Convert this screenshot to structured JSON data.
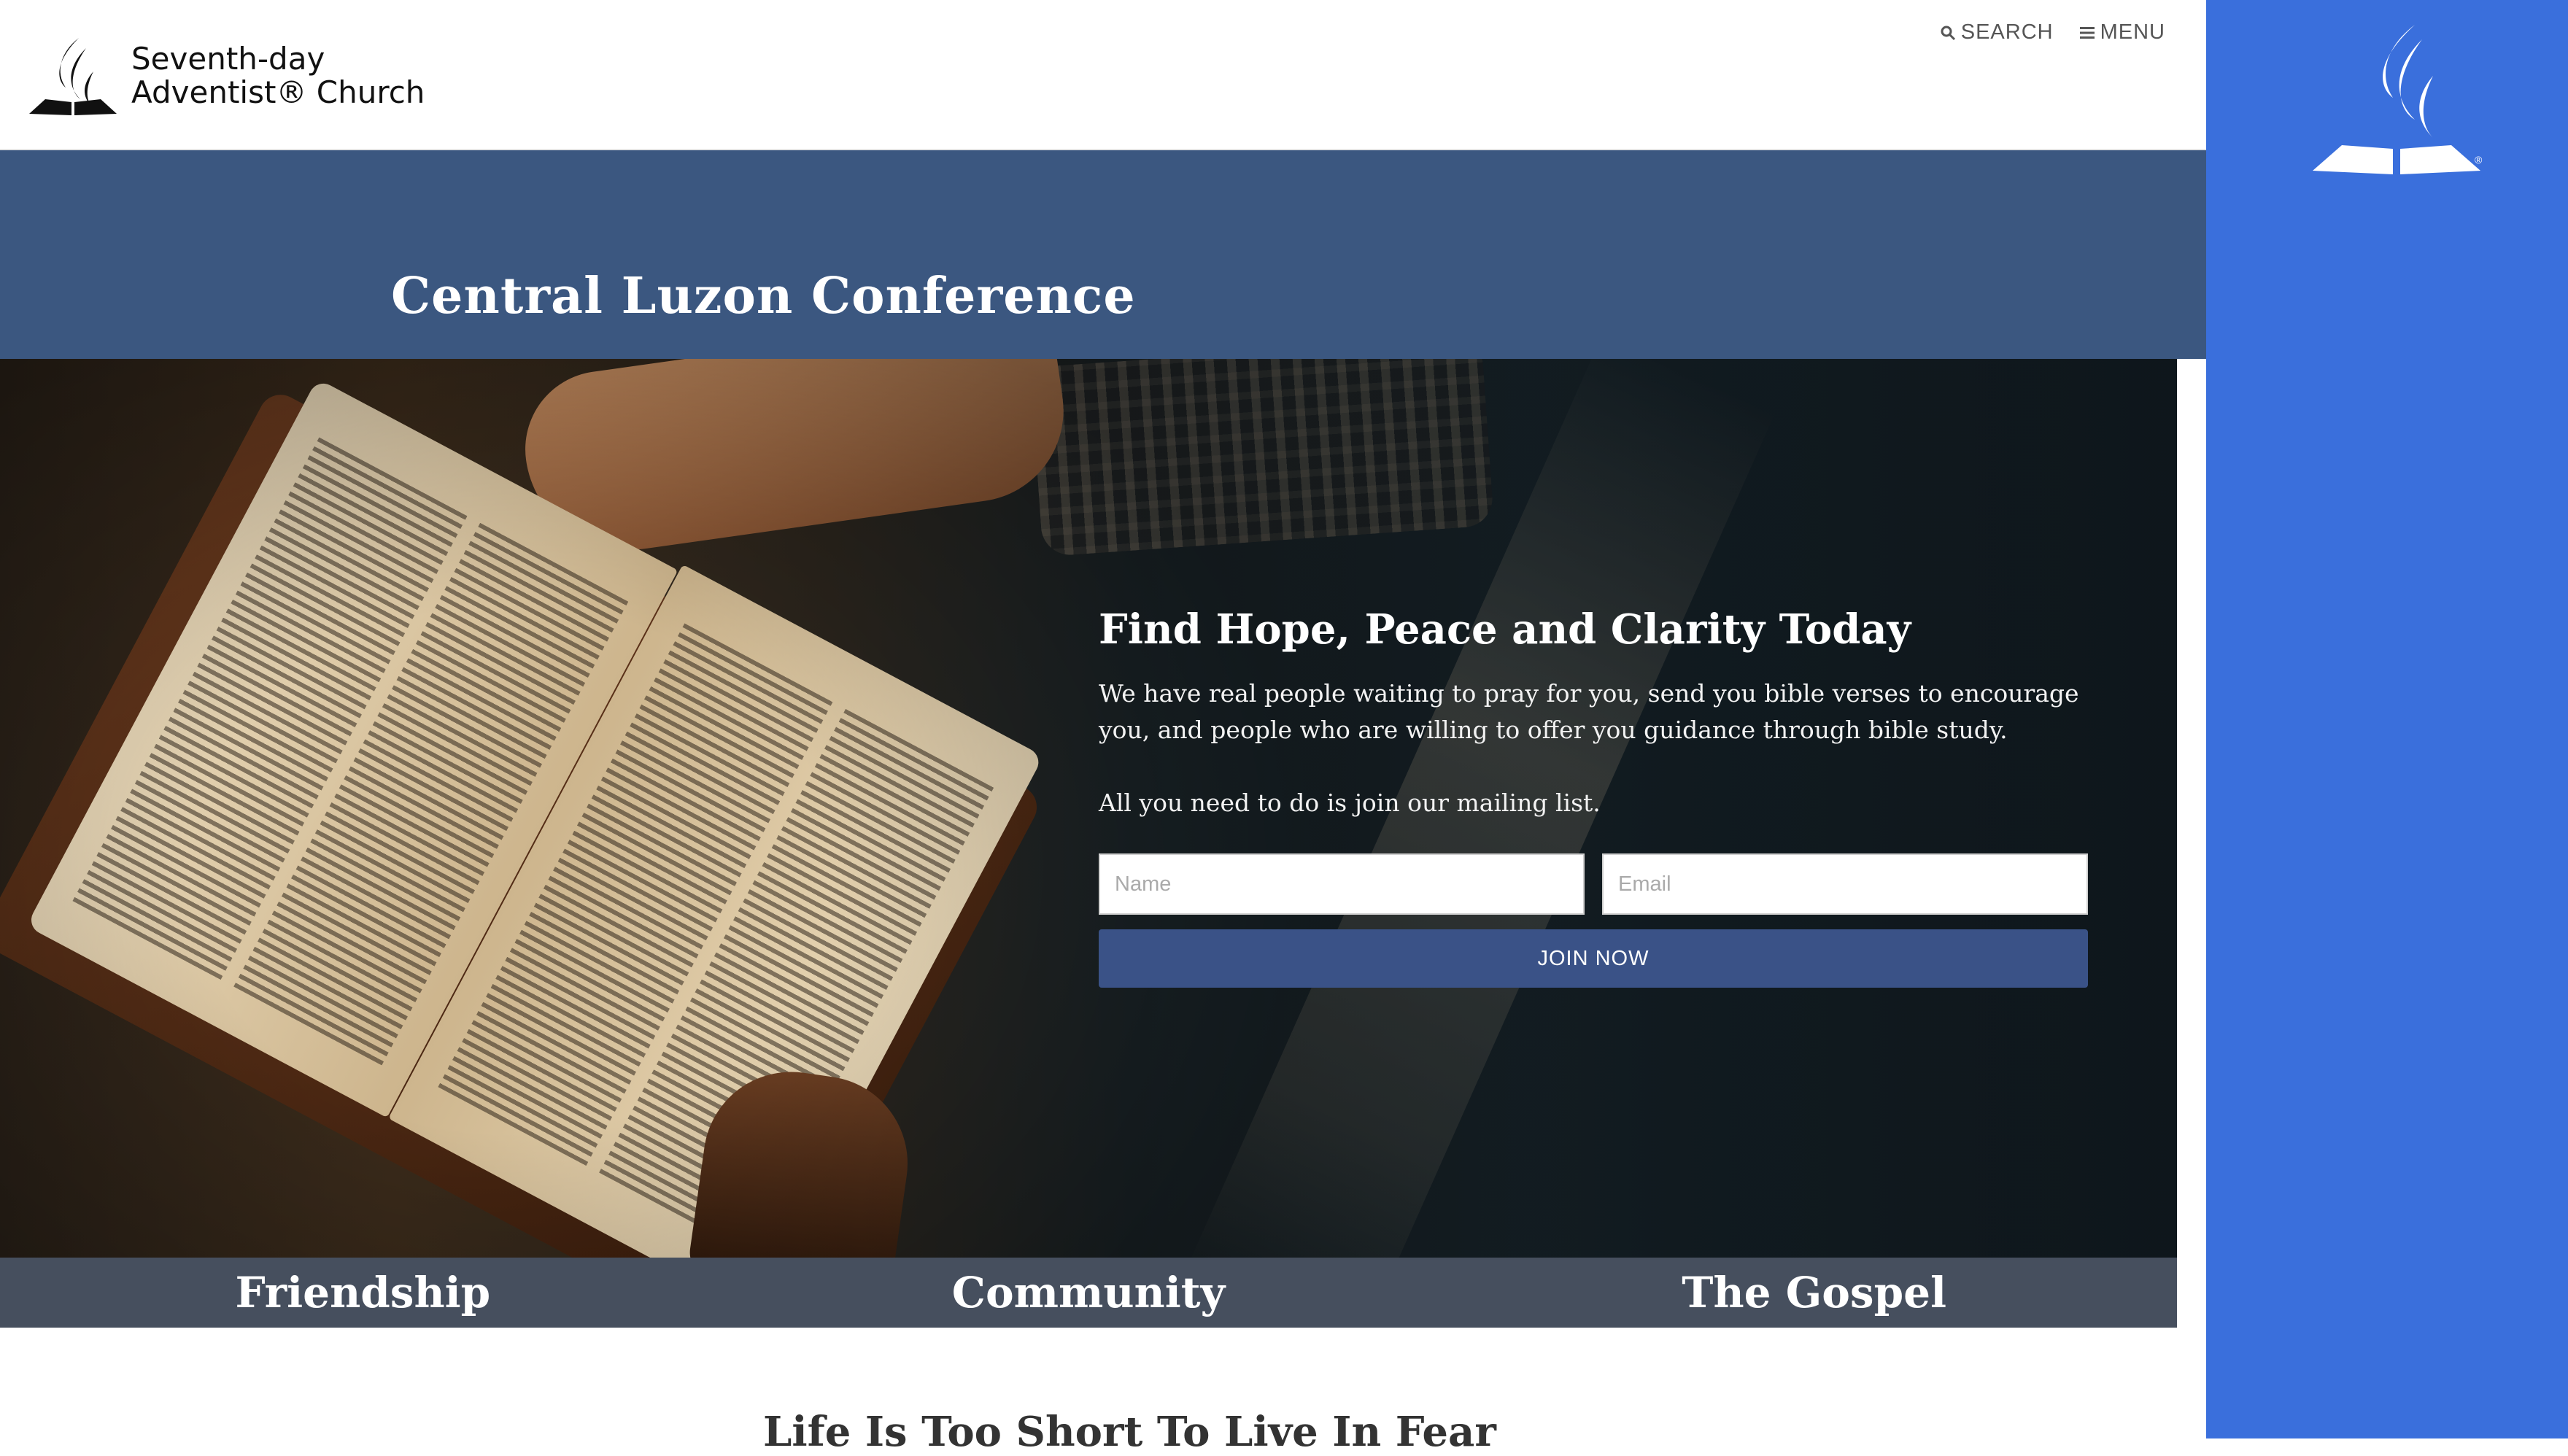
{
  "header": {
    "brand_line1": "Seventh-day",
    "brand_line2": "Adventist® Church",
    "search_label": "SEARCH",
    "menu_label": "MENU"
  },
  "conference": {
    "title": "Central Luzon Conference"
  },
  "hero": {
    "title": "Find Hope, Peace and Clarity Today",
    "body": "We have real people waiting to pray for you, send you bible verses to encourage you, and people who are willing to offer you guidance through bible study.",
    "body2": "All you need to do is join our mailing list.",
    "name_placeholder": "Name",
    "email_placeholder": "Email",
    "join_label": "JOIN NOW"
  },
  "features": {
    "items": [
      "Friendship",
      "Community",
      "The Gospel"
    ]
  },
  "section": {
    "title": "Life Is Too Short To Live In Fear"
  },
  "colors": {
    "rail": "#3a6fdc",
    "conference_band": "#3b5780",
    "button": "#3a5287",
    "strip": "#464f5e"
  }
}
